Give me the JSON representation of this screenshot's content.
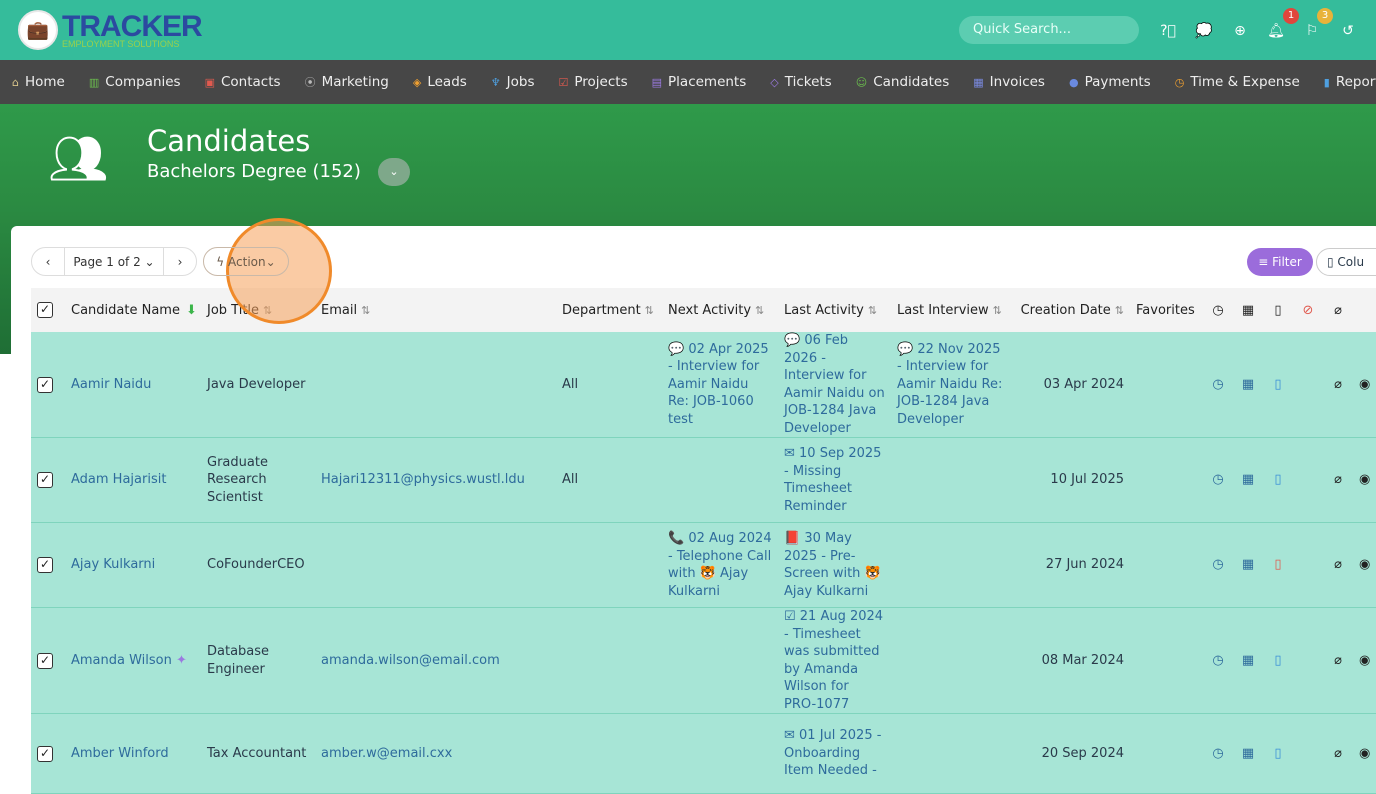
{
  "brand": {
    "name": "TRACKER",
    "tagline": "EMPLOYMENT SOLUTIONS"
  },
  "topbar": {
    "search_placeholder": "Quick Search...",
    "notifications_count": "1",
    "flags_count": "3"
  },
  "nav": [
    {
      "label": "Home",
      "icon": "⌂",
      "color": "#d9c58a"
    },
    {
      "label": "Companies",
      "icon": "▥",
      "color": "#6bbf4e"
    },
    {
      "label": "Contacts",
      "icon": "▣",
      "color": "#e05a4f"
    },
    {
      "label": "Marketing",
      "icon": "⦿",
      "color": "#bbb"
    },
    {
      "label": "Leads",
      "icon": "◈",
      "color": "#f0a030"
    },
    {
      "label": "Jobs",
      "icon": "♆",
      "color": "#4fa0e0"
    },
    {
      "label": "Projects",
      "icon": "☑",
      "color": "#e05a4f"
    },
    {
      "label": "Placements",
      "icon": "▤",
      "color": "#9b7ae0"
    },
    {
      "label": "Tickets",
      "icon": "◇",
      "color": "#9b7ae0"
    },
    {
      "label": "Candidates",
      "icon": "☺",
      "color": "#6bbf4e"
    },
    {
      "label": "Invoices",
      "icon": "▦",
      "color": "#7a8ae0"
    },
    {
      "label": "Payments",
      "icon": "●",
      "color": "#6a8ae0"
    },
    {
      "label": "Time & Expense",
      "icon": "◷",
      "color": "#f0a030"
    },
    {
      "label": "Reporting",
      "icon": "▮",
      "color": "#4fa0e0"
    }
  ],
  "header": {
    "title": "Candidates",
    "subtitle": "Bachelors Degree (152)"
  },
  "toolbar": {
    "prev": "‹",
    "page": "Page 1 of 2",
    "next": "›",
    "action": "Action",
    "filter": "Filter",
    "columns": "Colu"
  },
  "columns": [
    "Candidate Name",
    "Job Title",
    "Email",
    "Department",
    "Next Activity",
    "Last Activity",
    "Last Interview",
    "Creation Date",
    "Favorites"
  ],
  "rows": [
    {
      "name": "Aamir Naidu",
      "job": "Java Developer",
      "email": "",
      "dept": "All",
      "next": "💬 02 Apr 2025 - Interview for Aamir Naidu Re: JOB-1060 test",
      "last": "💬 06 Feb 2026 - Interview for Aamir Naidu on JOB-1284 Java Developer",
      "interview": "💬 22 Nov 2025 - Interview for Aamir Naidu Re: JOB-1284 Java Developer",
      "created": "03 Apr 2024",
      "pin": "",
      "doc_color": "#3a8fd8"
    },
    {
      "name": "Adam Hajarisit",
      "job": "Graduate Research Scientist",
      "email": "Hajari12311@physics.wustl.ldu",
      "dept": "All",
      "next": "",
      "last": "✉ 10 Sep 2025 - Missing Timesheet Reminder",
      "interview": "",
      "created": "10 Jul 2025",
      "pin": "",
      "doc_color": "#3a8fd8"
    },
    {
      "name": "Ajay Kulkarni",
      "job": "CoFounderCEO",
      "email": "",
      "dept": "",
      "next": "📞 02 Aug 2024 - Telephone Call with 🐯 Ajay Kulkarni",
      "last": "📕 30 May 2025 - Pre-Screen with 🐯 Ajay Kulkarni",
      "interview": "",
      "created": "27 Jun 2024",
      "pin": "",
      "doc_color": "#e05a4f"
    },
    {
      "name": "Amanda Wilson",
      "job": "Database Engineer",
      "email": "amanda.wilson@email.com",
      "dept": "",
      "next": "",
      "last": "☑ 21 Aug 2024 - Timesheet was submitted by Amanda Wilson for PRO-1077",
      "interview": "",
      "created": "08 Mar 2024",
      "pin": "✦",
      "doc_color": "#3a8fd8"
    },
    {
      "name": "Amber Winford",
      "job": "Tax Accountant",
      "email": "amber.w@email.cxx",
      "dept": "",
      "next": "",
      "last": "✉ 01 Jul 2025 - Onboarding Item Needed -",
      "interview": "",
      "created": "20 Sep 2024",
      "pin": "",
      "doc_color": "#3a8fd8"
    }
  ]
}
